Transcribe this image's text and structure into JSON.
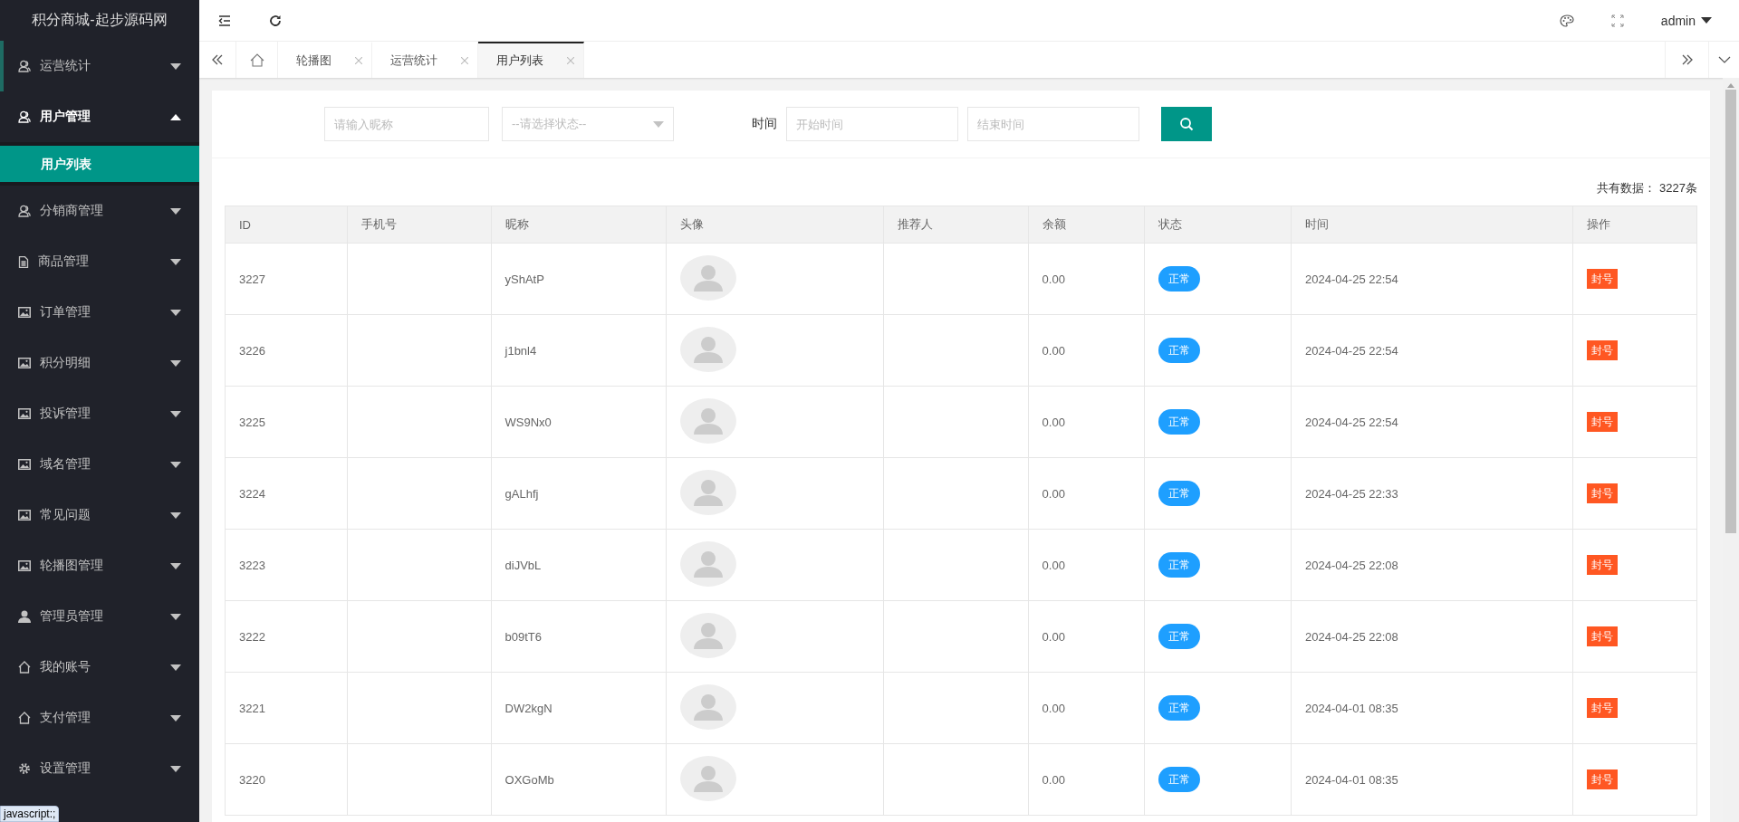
{
  "logo": "积分商城-起步源码网",
  "header": {
    "user": "admin"
  },
  "sidebar": {
    "items": [
      {
        "label": "运营统计",
        "expanded": false,
        "marked": true
      },
      {
        "label": "用户管理",
        "expanded": true,
        "marked": false,
        "children": [
          {
            "label": "用户列表",
            "selected": true
          }
        ]
      },
      {
        "label": "分销商管理",
        "expanded": false,
        "marked": false
      },
      {
        "label": "商品管理",
        "expanded": false,
        "marked": false
      },
      {
        "label": "订单管理",
        "expanded": false,
        "marked": false
      },
      {
        "label": "积分明细",
        "expanded": false,
        "marked": false
      },
      {
        "label": "投诉管理",
        "expanded": false,
        "marked": false
      },
      {
        "label": "域名管理",
        "expanded": false,
        "marked": false
      },
      {
        "label": "常见问题",
        "expanded": false,
        "marked": false
      },
      {
        "label": "轮播图管理",
        "expanded": false,
        "marked": false
      },
      {
        "label": "管理员管理",
        "expanded": false,
        "marked": false
      },
      {
        "label": "我的账号",
        "expanded": false,
        "marked": false
      },
      {
        "label": "支付管理",
        "expanded": false,
        "marked": false
      },
      {
        "label": "设置管理",
        "expanded": false,
        "marked": false
      }
    ]
  },
  "tabs": [
    {
      "label": "轮播图",
      "selected": false
    },
    {
      "label": "运营统计",
      "selected": false
    },
    {
      "label": "用户列表",
      "selected": true
    }
  ],
  "filters": {
    "nickname": {
      "placeholder": "请输入昵称"
    },
    "status": {
      "placeholder": "--请选择状态--"
    },
    "time_label": "时间",
    "start": {
      "placeholder": "开始时间"
    },
    "end": {
      "placeholder": "结束时间"
    }
  },
  "total": {
    "label": "共有数据：",
    "value": "3227条"
  },
  "table": {
    "columns": [
      "ID",
      "手机号",
      "昵称",
      "头像",
      "推荐人",
      "余额",
      "状态",
      "时间",
      "操作"
    ],
    "rows": [
      {
        "id": "3227",
        "nickname": "yShAtP",
        "balance": "0.00",
        "status": "正常",
        "time": "2024-04-25 22:54",
        "action": "封号"
      },
      {
        "id": "3226",
        "nickname": "j1bnl4",
        "balance": "0.00",
        "status": "正常",
        "time": "2024-04-25 22:54",
        "action": "封号"
      },
      {
        "id": "3225",
        "nickname": "WS9Nx0",
        "balance": "0.00",
        "status": "正常",
        "time": "2024-04-25 22:54",
        "action": "封号"
      },
      {
        "id": "3224",
        "nickname": "gALhfj",
        "balance": "0.00",
        "status": "正常",
        "time": "2024-04-25 22:33",
        "action": "封号"
      },
      {
        "id": "3223",
        "nickname": "diJVbL",
        "balance": "0.00",
        "status": "正常",
        "time": "2024-04-25 22:08",
        "action": "封号"
      },
      {
        "id": "3222",
        "nickname": "b09tT6",
        "balance": "0.00",
        "status": "正常",
        "time": "2024-04-25 22:08",
        "action": "封号"
      },
      {
        "id": "3221",
        "nickname": "DW2kgN",
        "balance": "0.00",
        "status": "正常",
        "time": "2024-04-01 08:35",
        "action": "封号"
      },
      {
        "id": "3220",
        "nickname": "OXGoMb",
        "balance": "0.00",
        "status": "正常",
        "time": "2024-04-01 08:35",
        "action": "封号"
      }
    ]
  },
  "status_bar": "javascript:;"
}
